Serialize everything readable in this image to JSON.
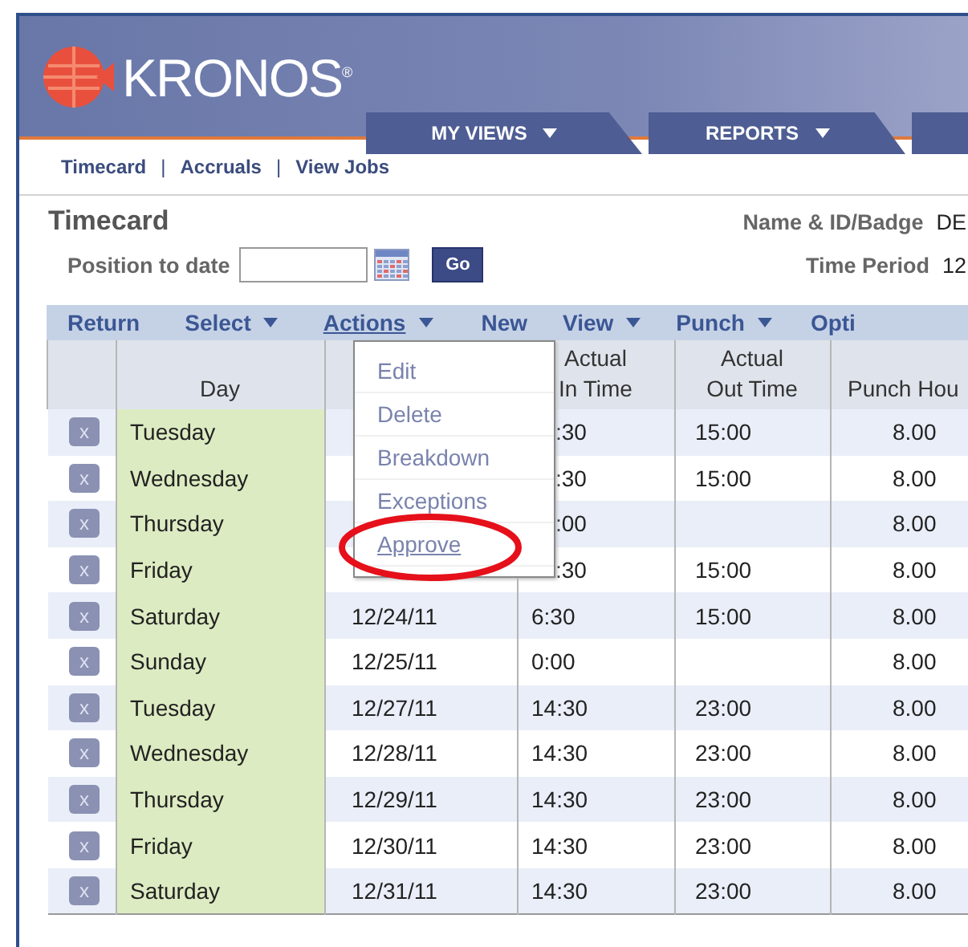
{
  "header": {
    "logo": "KRONOS",
    "logo_mark": "®",
    "tabs": [
      {
        "label": "MY VIEWS",
        "has_menu": true
      },
      {
        "label": "REPORTS",
        "has_menu": true
      },
      {
        "has_menu": false
      }
    ]
  },
  "subnav": {
    "links": [
      "Timecard",
      "Accruals",
      "View Jobs"
    ],
    "separator": "|"
  },
  "title": "Timecard",
  "name_label": "Name & ID/Badge",
  "name_value": "DE",
  "position_label": "Position to date",
  "go_button": "Go",
  "period_label": "Time Period",
  "period_value": "12",
  "toolbar": [
    {
      "label": "Return",
      "has_menu": false,
      "selected": false
    },
    {
      "label": "Select",
      "has_menu": true,
      "selected": false
    },
    {
      "label": "Actions",
      "has_menu": true,
      "selected": true
    },
    {
      "label": "New",
      "has_menu": false,
      "selected": false
    },
    {
      "label": "View",
      "has_menu": true,
      "selected": false
    },
    {
      "label": "Punch",
      "has_menu": true,
      "selected": false
    },
    {
      "label": "Opti",
      "has_menu": false,
      "selected": false
    }
  ],
  "table": {
    "columns": [
      {},
      {
        "lines": [
          "Day"
        ]
      },
      {},
      {
        "lines": [
          "Actual",
          "In Time"
        ]
      },
      {
        "lines": [
          "Actual",
          "Out Time"
        ]
      },
      {
        "lines": [
          "Punch Hou"
        ]
      }
    ],
    "rows": [
      {
        "delete": "x",
        "day": "Tuesday",
        "date": "",
        "in_time": ":30",
        "out_time": "15:00",
        "punch_hours": "8.00",
        "covered": true
      },
      {
        "delete": "x",
        "day": "Wednesday",
        "date": "",
        "in_time": ":30",
        "out_time": "15:00",
        "punch_hours": "8.00",
        "covered": true
      },
      {
        "delete": "x",
        "day": "Thursday",
        "date": "",
        "in_time": ":00",
        "out_time": "",
        "punch_hours": "8.00",
        "covered": true
      },
      {
        "delete": "x",
        "day": "Friday",
        "date": "",
        "in_time": ":30",
        "out_time": "15:00",
        "punch_hours": "8.00",
        "covered": true
      },
      {
        "delete": "x",
        "day": "Saturday",
        "date": "12/24/11",
        "in_time": "6:30",
        "out_time": "15:00",
        "punch_hours": "8.00",
        "covered": false
      },
      {
        "delete": "x",
        "day": "Sunday",
        "date": "12/25/11",
        "in_time": "0:00",
        "out_time": "",
        "punch_hours": "8.00",
        "covered": false
      },
      {
        "delete": "x",
        "day": "Tuesday",
        "date": "12/27/11",
        "in_time": "14:30",
        "out_time": "23:00",
        "punch_hours": "8.00",
        "covered": false
      },
      {
        "delete": "x",
        "day": "Wednesday",
        "date": "12/28/11",
        "in_time": "14:30",
        "out_time": "23:00",
        "punch_hours": "8.00",
        "covered": false
      },
      {
        "delete": "x",
        "day": "Thursday",
        "date": "12/29/11",
        "in_time": "14:30",
        "out_time": "23:00",
        "punch_hours": "8.00",
        "covered": false
      },
      {
        "delete": "x",
        "day": "Friday",
        "date": "12/30/11",
        "in_time": "14:30",
        "out_time": "23:00",
        "punch_hours": "8.00",
        "covered": false
      },
      {
        "delete": "x",
        "day": "Saturday",
        "date": "12/31/11",
        "in_time": "14:30",
        "out_time": "23:00",
        "punch_hours": "8.00",
        "covered": false
      }
    ]
  },
  "actions_menu": {
    "items": [
      {
        "label": "Edit",
        "selected": false
      },
      {
        "label": "Delete",
        "selected": false
      },
      {
        "label": "Breakdown",
        "selected": false
      },
      {
        "label": "Exceptions",
        "selected": false
      },
      {
        "label": "Approve",
        "selected": true
      }
    ],
    "circled": true
  }
}
